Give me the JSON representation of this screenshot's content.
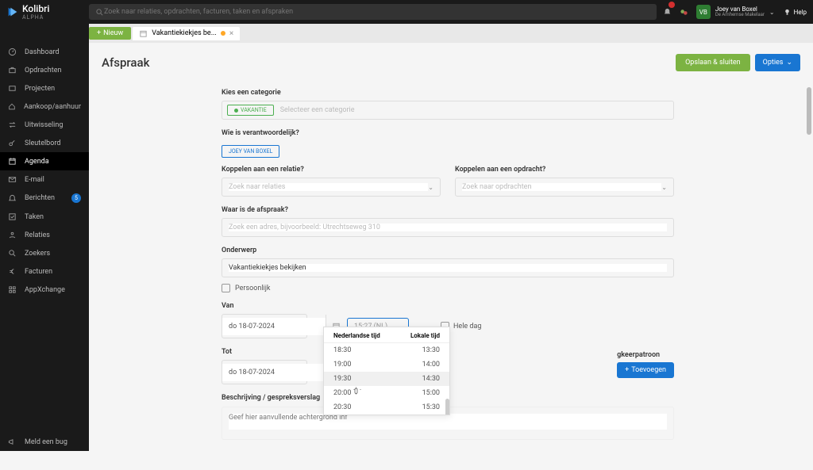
{
  "app": {
    "name": "Kolibri",
    "edition": "ALPHA"
  },
  "search": {
    "placeholder": "Zoek naar relaties, opdrachten, facturen, taken en afspraken"
  },
  "header": {
    "notif_count": " ",
    "user_initials": "VB",
    "user_name": "Joey van Boxel",
    "user_subtitle": "De Arnhemse Makelaar",
    "help": "Help"
  },
  "tabs": {
    "new_label": "Nieuw",
    "active_label": "Vakantiekiekjes be..."
  },
  "nav": {
    "items": [
      "Dashboard",
      "Opdrachten",
      "Projecten",
      "Aankoop/aanhuur",
      "Uitwisseling",
      "Sleutelbord",
      "Agenda",
      "E-mail",
      "Berichten",
      "Taken",
      "Relaties",
      "Zoekers",
      "Facturen",
      "AppXchange"
    ],
    "badge_count": "5",
    "bug": "Meld een bug"
  },
  "page": {
    "title": "Afspraak",
    "save": "Opslaan & sluiten",
    "options": "Opties"
  },
  "form": {
    "category_label": "Kies een categorie",
    "category_chip": "VAKANTIE",
    "category_placeholder": "Selecteer een categorie",
    "responsible_label": "Wie is verantwoordelijk?",
    "responsible_chip": "JOEY VAN BOXEL",
    "relatie_label": "Koppelen aan een relatie?",
    "relatie_placeholder": "Zoek naar relaties",
    "opdracht_label": "Koppelen aan een opdracht?",
    "opdracht_placeholder": "Zoek naar opdrachten",
    "where_label": "Waar is de afspraak?",
    "where_placeholder": "Zoek een adres, bijvoorbeeld: Utrechtseweg 310",
    "subject_label": "Onderwerp",
    "subject_value": "Vakantiekiekjes bekijken",
    "personal": "Persoonlijk",
    "van_label": "Van",
    "van_date": "do 18-07-2024",
    "van_time": "15:27 (NL)",
    "hele_dag": "Hele dag",
    "tot_label": "Tot",
    "tot_date": "do 18-07-2024",
    "repeat_label": "gkeerpatroon",
    "add_button": "Toevoegen",
    "description_label": "Beschrijving / gespreksverslag",
    "description_placeholder": "Geef hier aanvullende achtergrond inf"
  },
  "timedd": {
    "col1_header": "Nederlandse tijd",
    "col2_header": "Lokale tijd",
    "rows": [
      {
        "nl": "18:30",
        "local": "13:30"
      },
      {
        "nl": "19:00",
        "local": "14:00"
      },
      {
        "nl": "19:30",
        "local": "14:30"
      },
      {
        "nl": "20:00",
        "local": "15:00"
      },
      {
        "nl": "20:30",
        "local": "15:30"
      }
    ]
  }
}
